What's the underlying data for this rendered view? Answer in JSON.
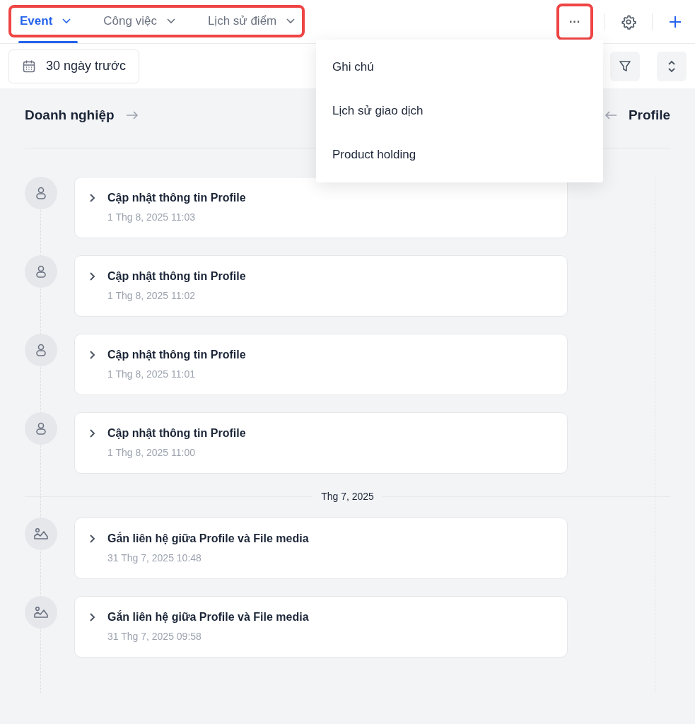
{
  "tabs": [
    {
      "label": "Event",
      "selected": true
    },
    {
      "label": "Công việc",
      "selected": false
    },
    {
      "label": "Lịch sử điểm",
      "selected": false
    }
  ],
  "tabs_highlighted": true,
  "more_button": {
    "label": "···",
    "highlighted": true
  },
  "date_filter": {
    "label": "30 ngày trước"
  },
  "more_menu": {
    "open": true,
    "items": [
      "Ghi chú",
      "Lịch sử giao dịch",
      "Product holding"
    ]
  },
  "left_heading": "Doanh nghiệp",
  "right_heading": "Profile",
  "groups": [
    {
      "events": [
        {
          "kind": "profile",
          "title": "Cập nhật thông tin Profile",
          "time": "1 Thg 8, 2025 11:03"
        },
        {
          "kind": "profile",
          "title": "Cập nhật thông tin Profile",
          "time": "1 Thg 8, 2025 11:02"
        },
        {
          "kind": "profile",
          "title": "Cập nhật thông tin Profile",
          "time": "1 Thg 8, 2025 11:01"
        },
        {
          "kind": "profile",
          "title": "Cập nhật thông tin Profile",
          "time": "1 Thg 8, 2025 11:00"
        }
      ]
    },
    {
      "header": "Thg 7, 2025",
      "events": [
        {
          "kind": "media",
          "title": "Gắn liên hệ giữa Profile và File media",
          "time": "31 Thg 7, 2025 10:48"
        },
        {
          "kind": "media",
          "title": "Gắn liên hệ giữa Profile và File media",
          "time": "31 Thg 7, 2025 09:58"
        }
      ]
    }
  ]
}
